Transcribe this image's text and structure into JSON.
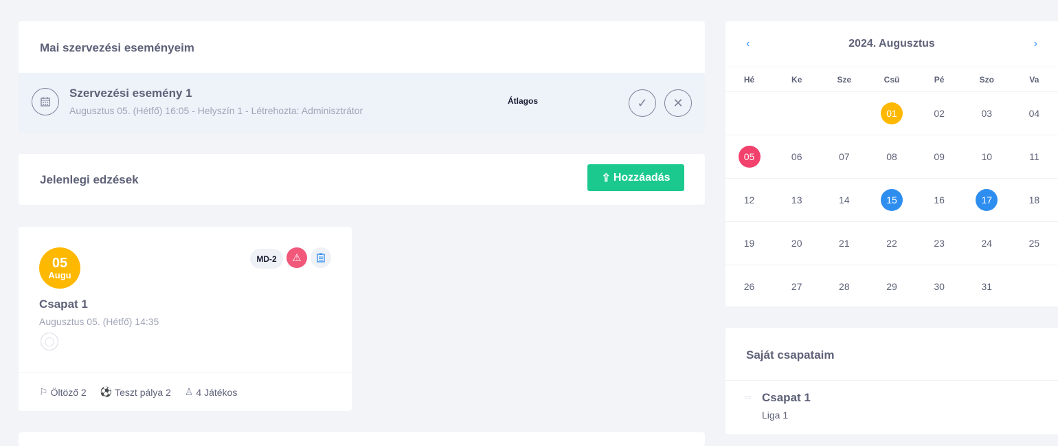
{
  "events_card": {
    "title": "Mai szervezési eseményeim",
    "event": {
      "title": "Szervezési esemény 1",
      "subtitle": "Augusztus 05. (Hétfő) 16:05 - Helyszín 1 - Létrehozta: Adminisztrátor",
      "badge": "Átlagos"
    }
  },
  "trainings_card": {
    "title": "Jelenlegi edzések",
    "add_label": "Hozzáadás"
  },
  "training": {
    "day": "05",
    "month": "Augu",
    "badge": "MD-2",
    "team": "Csapat 1",
    "datetime": "Augusztus 05. (Hétfő) 14:35",
    "locker": "Öltöző 2",
    "field": "Teszt pálya 2",
    "players": "4 Játékos"
  },
  "calendar": {
    "title": "2024. Augusztus",
    "weekdays": [
      "Hé",
      "Ke",
      "Sze",
      "Csü",
      "Pé",
      "Szo",
      "Va"
    ],
    "weeks": [
      [
        "",
        "",
        "",
        "01",
        "02",
        "03",
        "04"
      ],
      [
        "05",
        "06",
        "07",
        "08",
        "09",
        "10",
        "11"
      ],
      [
        "12",
        "13",
        "14",
        "15",
        "16",
        "17",
        "18"
      ],
      [
        "19",
        "20",
        "21",
        "22",
        "23",
        "24",
        "25"
      ],
      [
        "26",
        "27",
        "28",
        "29",
        "30",
        "31",
        ""
      ]
    ],
    "highlights": {
      "01": "#ffb800",
      "05": "#f1416c",
      "15": "#2e8ef0",
      "17": "#2e8ef0"
    }
  },
  "teams_card": {
    "title": "Saját csapataim",
    "teams": [
      {
        "name": "Csapat 1",
        "league": "Liga 1"
      }
    ]
  }
}
